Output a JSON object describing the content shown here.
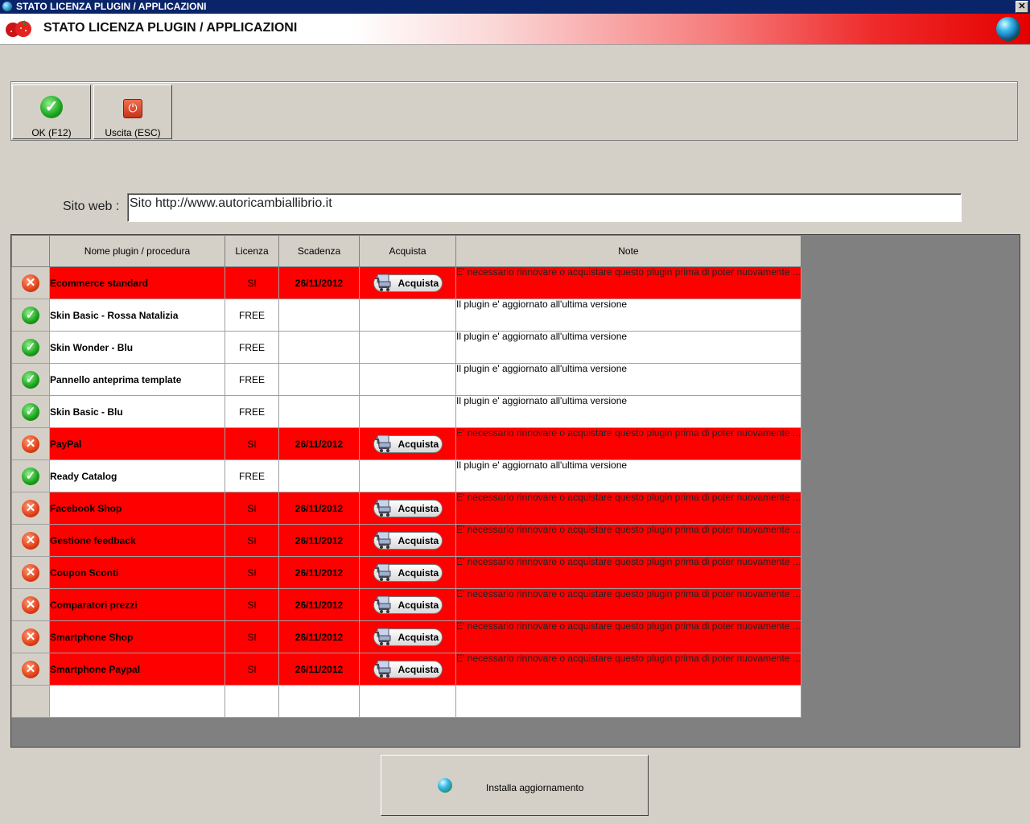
{
  "window": {
    "title": "STATO LICENZA PLUGIN / APPLICAZIONI",
    "close_glyph": "✕"
  },
  "banner": {
    "title": "STATO LICENZA PLUGIN / APPLICAZIONI",
    "logo_icon": "strawberry-icon",
    "globe_icon": "globe-icon"
  },
  "toolbar": {
    "ok_label": "OK (F12)",
    "exit_label": "Uscita (ESC)"
  },
  "site": {
    "label": "Sito web :",
    "value": "Sito http://www.autoricambiallibrio.it"
  },
  "table": {
    "headers": {
      "name": "Nome plugin / procedura",
      "license": "Licenza",
      "expiry": "Scadenza",
      "buy": "Acquista",
      "note": "Note"
    },
    "buy_button_label": "Acquista",
    "rows": [
      {
        "status": "error",
        "name": "Ecommerce standard",
        "license": "SI",
        "expiry": "26/11/2012",
        "buy": true,
        "note": "E' necessario rinnovare o acquistare questo plugin prima di poter nuovamente ..."
      },
      {
        "status": "ok",
        "name": "Skin Basic - Rossa Natalizia",
        "license": "FREE",
        "expiry": "",
        "buy": false,
        "note": "Il plugin e' aggiornato all'ultima versione"
      },
      {
        "status": "ok",
        "name": "Skin Wonder - Blu",
        "license": "FREE",
        "expiry": "",
        "buy": false,
        "note": "Il plugin e' aggiornato all'ultima versione"
      },
      {
        "status": "ok",
        "name": "Pannello anteprima template",
        "license": "FREE",
        "expiry": "",
        "buy": false,
        "note": "Il plugin e' aggiornato all'ultima versione"
      },
      {
        "status": "ok",
        "name": "Skin Basic - Blu",
        "license": "FREE",
        "expiry": "",
        "buy": false,
        "note": "Il plugin e' aggiornato all'ultima versione"
      },
      {
        "status": "error",
        "name": "PayPal",
        "license": "SI",
        "expiry": "26/11/2012",
        "buy": true,
        "note": "E' necessario rinnovare o acquistare questo plugin prima di poter nuovamente ..."
      },
      {
        "status": "ok",
        "name": "Ready Catalog",
        "license": "FREE",
        "expiry": "",
        "buy": false,
        "note": "Il plugin e' aggiornato all'ultima versione"
      },
      {
        "status": "error",
        "name": "Facebook Shop",
        "license": "SI",
        "expiry": "26/11/2012",
        "buy": true,
        "note": "E' necessario rinnovare o acquistare questo plugin prima di poter nuovamente ..."
      },
      {
        "status": "error",
        "name": "Gestione feedback",
        "license": "SI",
        "expiry": "26/11/2012",
        "buy": true,
        "note": "E' necessario rinnovare o acquistare questo plugin prima di poter nuovamente ..."
      },
      {
        "status": "error",
        "name": "Coupon Sconti",
        "license": "SI",
        "expiry": "26/11/2012",
        "buy": true,
        "note": "E' necessario rinnovare o acquistare questo plugin prima di poter nuovamente ..."
      },
      {
        "status": "error",
        "name": "Comparatori prezzi",
        "license": "SI",
        "expiry": "26/11/2012",
        "buy": true,
        "note": "E' necessario rinnovare o acquistare questo plugin prima di poter nuovamente ..."
      },
      {
        "status": "error",
        "name": "Smartphone Shop",
        "license": "SI",
        "expiry": "26/11/2012",
        "buy": true,
        "note": "E' necessario rinnovare o acquistare questo plugin prima di poter nuovamente ..."
      },
      {
        "status": "error",
        "name": "Smartphone Paypal",
        "license": "SI",
        "expiry": "26/11/2012",
        "buy": true,
        "note": "E' necessario rinnovare o acquistare questo plugin prima di poter nuovamente ..."
      }
    ]
  },
  "footer": {
    "install_label": "Installa aggiornamento"
  },
  "colors": {
    "error_row": "#ff0000",
    "ok_icon": "#18a018",
    "error_icon": "#e04016",
    "titlebar": "#0a246a",
    "face": "#d4d0c8"
  }
}
